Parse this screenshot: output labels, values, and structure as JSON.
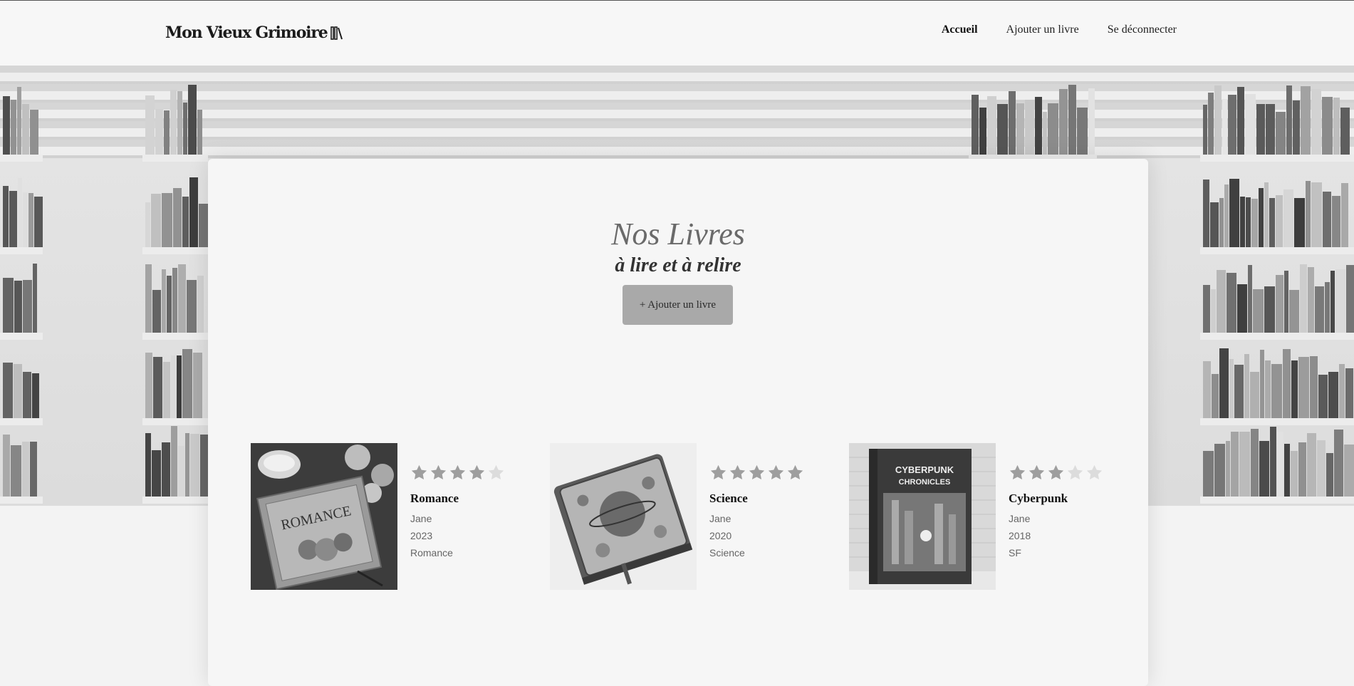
{
  "header": {
    "logo_text": "Mon Vieux Grimoire",
    "logo_icon": "books-icon",
    "nav": [
      {
        "label": "Accueil",
        "active": true
      },
      {
        "label": "Ajouter un livre",
        "active": false
      },
      {
        "label": "Se déconnecter",
        "active": false
      }
    ]
  },
  "main": {
    "title": "Nos Livres",
    "subtitle": "à lire et à relire",
    "add_button": "+ Ajouter un livre"
  },
  "books": [
    {
      "title": "Romance",
      "author": "Jane",
      "year": "2023",
      "genre": "Romance",
      "rating": 4,
      "cover_text": "ROMANCE"
    },
    {
      "title": "Science",
      "author": "Jane",
      "year": "2020",
      "genre": "Science",
      "rating": 5,
      "cover_text": ""
    },
    {
      "title": "Cyberpunk",
      "author": "Jane",
      "year": "2018",
      "genre": "SF",
      "rating": 3,
      "cover_text": "CYBERPUNK CHRONICLES"
    }
  ],
  "colors": {
    "star_filled": "#9e9e9e",
    "star_empty": "#dcdcdc",
    "button_bg": "#a9a9a9"
  }
}
